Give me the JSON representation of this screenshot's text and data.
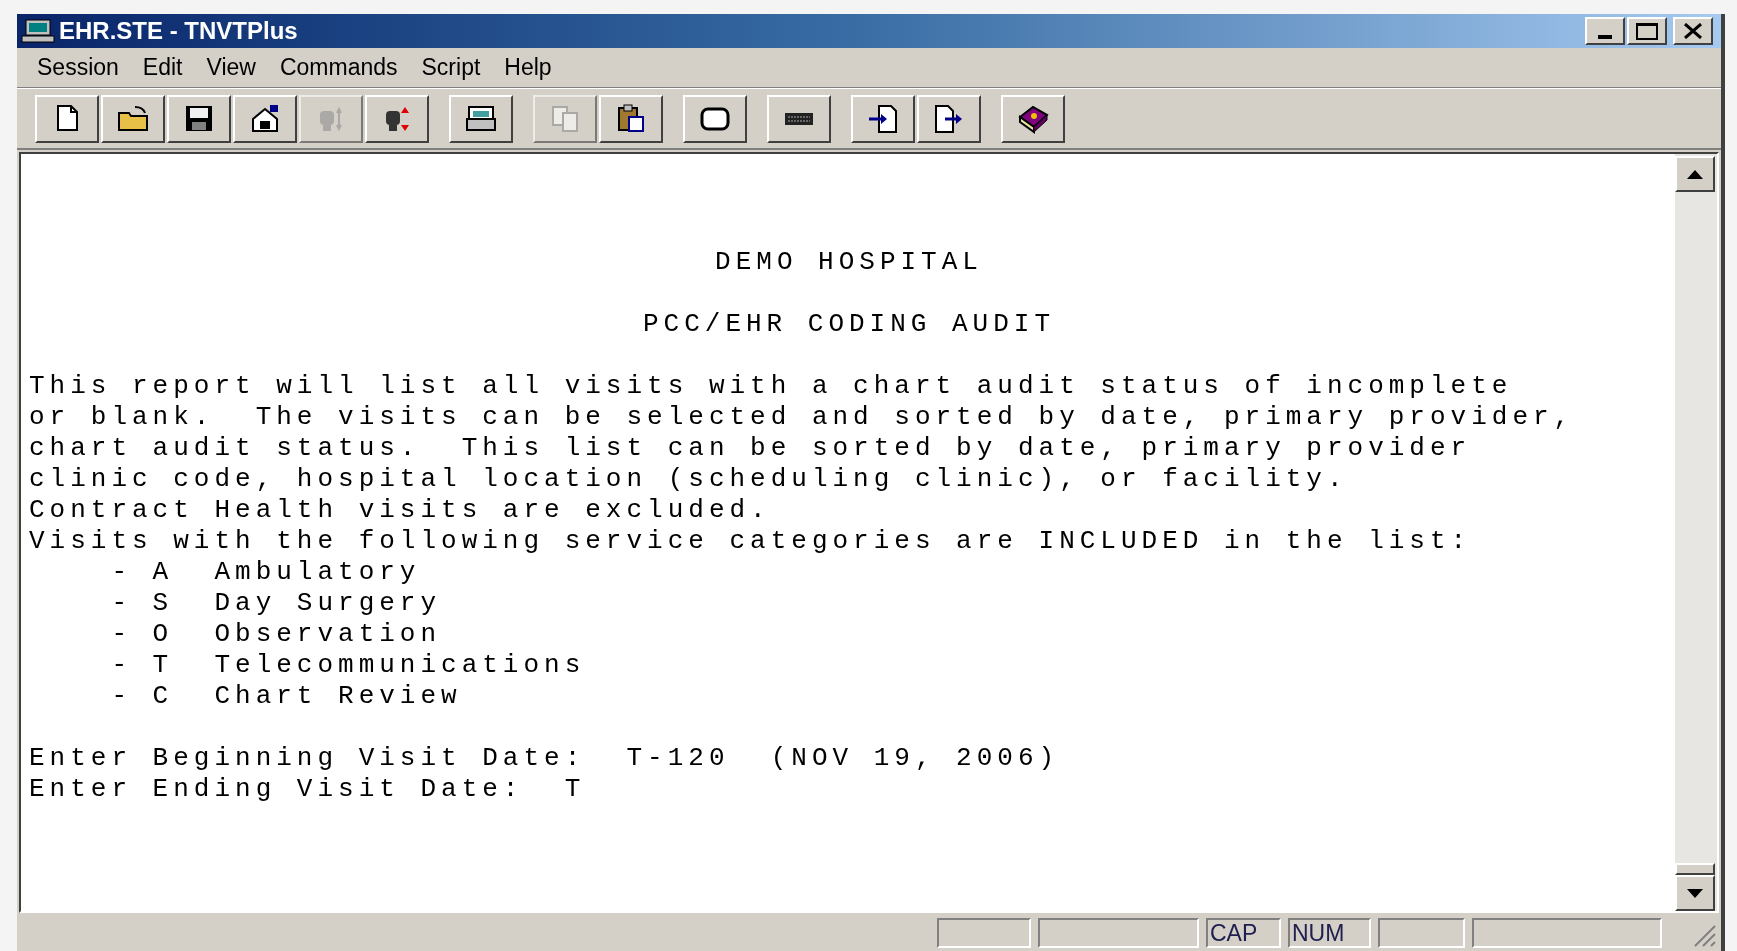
{
  "window": {
    "title": "EHR.STE - TNVTPlus"
  },
  "menu": [
    "Session",
    "Edit",
    "View",
    "Commands",
    "Script",
    "Help"
  ],
  "toolbar": [
    {
      "kind": "new",
      "disabled": false
    },
    {
      "kind": "open",
      "disabled": false
    },
    {
      "kind": "save",
      "disabled": false
    },
    {
      "kind": "properties",
      "disabled": false
    },
    {
      "kind": "connect",
      "disabled": true
    },
    {
      "kind": "disconnect",
      "disabled": false
    },
    {
      "kind": "gap"
    },
    {
      "kind": "print",
      "disabled": false
    },
    {
      "kind": "gap"
    },
    {
      "kind": "copy",
      "disabled": true
    },
    {
      "kind": "paste",
      "disabled": false
    },
    {
      "kind": "gap"
    },
    {
      "kind": "screen",
      "disabled": false
    },
    {
      "kind": "gap"
    },
    {
      "kind": "keyboard",
      "disabled": false
    },
    {
      "kind": "gap"
    },
    {
      "kind": "send",
      "disabled": false
    },
    {
      "kind": "receive",
      "disabled": false
    },
    {
      "kind": "gap"
    },
    {
      "kind": "help",
      "disabled": false
    }
  ],
  "terminal": {
    "lines": [
      {
        "kind": "blank"
      },
      {
        "kind": "blank"
      },
      {
        "kind": "blank"
      },
      {
        "kind": "heading",
        "text": "DEMO HOSPITAL"
      },
      {
        "kind": "blank"
      },
      {
        "kind": "heading",
        "text": "PCC/EHR CODING AUDIT"
      },
      {
        "kind": "blank"
      },
      {
        "kind": "text",
        "text": "This report will list all visits with a chart audit status of incomplete"
      },
      {
        "kind": "text",
        "text": "or blank.  The visits can be selected and sorted by date, primary provider,"
      },
      {
        "kind": "text",
        "text": "chart audit status.  This list can be sorted by date, primary provider"
      },
      {
        "kind": "text",
        "text": "clinic code, hospital location (scheduling clinic), or facility."
      },
      {
        "kind": "text",
        "text": "Contract Health visits are excluded."
      },
      {
        "kind": "text",
        "text": "Visits with the following service categories are INCLUDED in the list:"
      },
      {
        "kind": "text",
        "text": "    - A  Ambulatory"
      },
      {
        "kind": "text",
        "text": "    - S  Day Surgery"
      },
      {
        "kind": "text",
        "text": "    - O  Observation"
      },
      {
        "kind": "text",
        "text": "    - T  Telecommunications"
      },
      {
        "kind": "text",
        "text": "    - C  Chart Review"
      },
      {
        "kind": "blank"
      },
      {
        "kind": "text",
        "text": "Enter Beginning Visit Date:  T-120  (NOV 19, 2006)"
      },
      {
        "kind": "text",
        "text": "Enter Ending Visit Date:  T"
      }
    ]
  },
  "status_bar": {
    "indicators": [
      "CAP",
      "NUM"
    ]
  }
}
